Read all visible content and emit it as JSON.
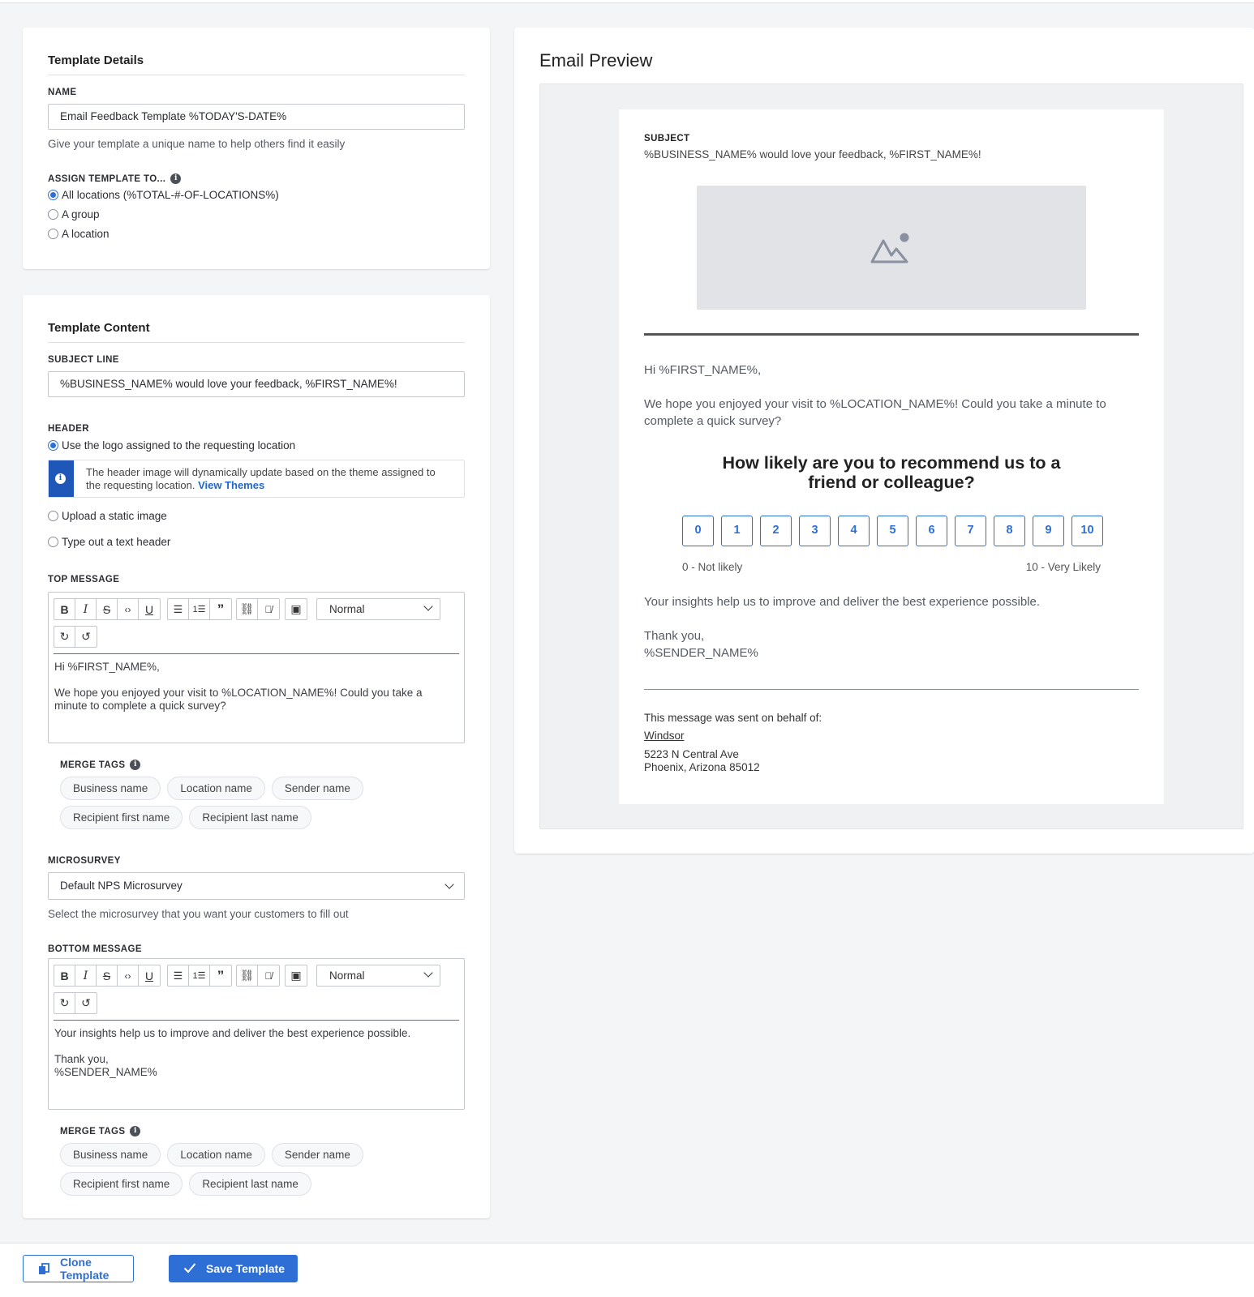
{
  "details": {
    "title": "Template Details",
    "name_label": "NAME",
    "name_value": "Email Feedback Template %TODAY'S-DATE%",
    "name_help": "Give your template a unique name to help others find it easily",
    "assign_label": "ASSIGN TEMPLATE TO...",
    "assign_options": [
      "All locations (%TOTAL-#-OF-LOCATIONS%)",
      "A group",
      "A location"
    ],
    "assign_selected": 0
  },
  "content": {
    "title": "Template Content",
    "subject_label": "SUBJECT LINE",
    "subject_value": "%BUSINESS_NAME% would love your feedback, %FIRST_NAME%!",
    "header_label": "HEADER",
    "header_options": [
      "Use the logo assigned to the requesting location",
      "Upload a static image",
      "Type out a text header"
    ],
    "header_notice": "The header image will dynamically update based on the theme assigned to the requesting location.",
    "header_notice_link": "View Themes",
    "top_message_label": "TOP MESSAGE",
    "top_message_text": "Hi %FIRST_NAME%,\n\nWe hope you enjoyed your visit to %LOCATION_NAME%! Could you take a minute to complete a quick survey?",
    "editor_style": "Normal",
    "merge_tags_label": "MERGE TAGS",
    "merge_tags_row1": [
      "Business name",
      "Location name",
      "Sender name"
    ],
    "merge_tags_row2": [
      "Recipient first name",
      "Recipient last name"
    ],
    "microsurvey_label": "MICROSURVEY",
    "microsurvey_value": "Default NPS Microsurvey",
    "microsurvey_help": "Select the microsurvey that you want your customers to fill out",
    "bottom_message_label": "BOTTOM MESSAGE",
    "bottom_message_text": "Your insights help us to improve and deliver the best experience possible.\n\nThank you,\n%SENDER_NAME%"
  },
  "preview": {
    "title": "Email Preview",
    "subject_label": "SUBJECT",
    "subject": "%BUSINESS_NAME% would love your feedback, %FIRST_NAME%!",
    "greeting": "Hi %FIRST_NAME%,",
    "intro": "We hope you enjoyed your visit to %LOCATION_NAME%! Could you take a minute to complete a quick survey?",
    "nps_question": "How likely are you to recommend us to a friend or colleague?",
    "nps_scale": [
      "0",
      "1",
      "2",
      "3",
      "4",
      "5",
      "6",
      "7",
      "8",
      "9",
      "10"
    ],
    "nps_low": "0 - Not likely",
    "nps_high": "10 - Very Likely",
    "outro": "Your insights help us to improve and deliver the best experience possible.",
    "thanks": "Thank you,",
    "sender": "%SENDER_NAME%",
    "footer_label": "This message was sent on behalf of:",
    "business": "Windsor",
    "address1": "5223 N Central Ave",
    "address2": "Phoenix, Arizona 85012"
  },
  "actions": {
    "clone": "Clone Template",
    "save": "Save Template"
  },
  "colors": {
    "accent": "#2e6fd6",
    "notice_bar": "#1f57b8"
  }
}
